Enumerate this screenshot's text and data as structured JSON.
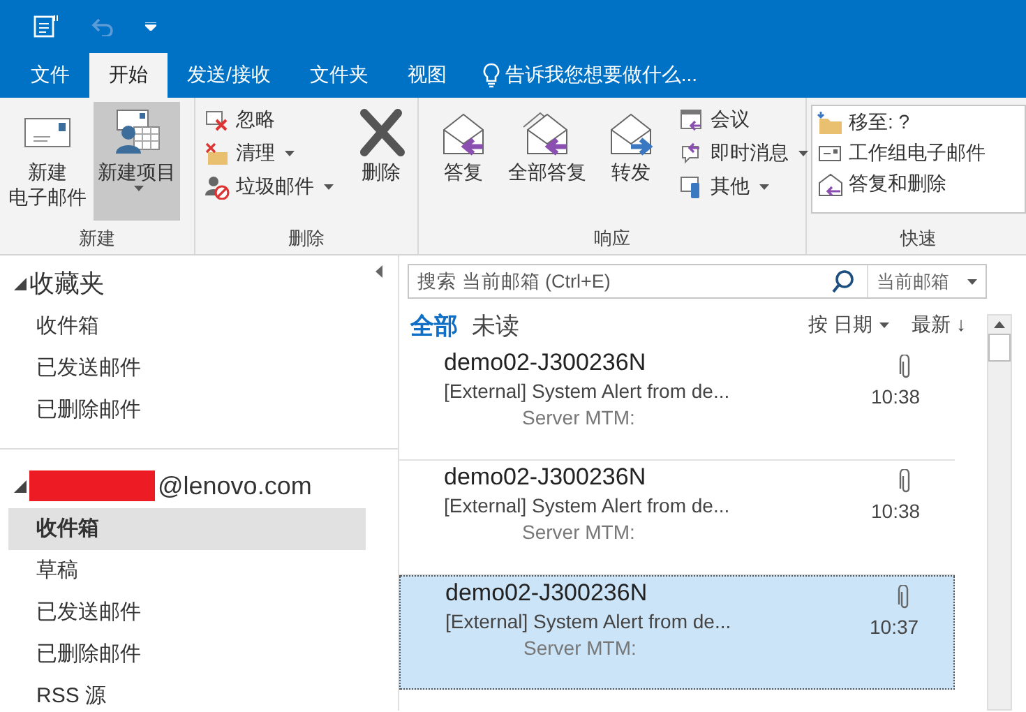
{
  "tabs": [
    {
      "label": "文件",
      "selected": false
    },
    {
      "label": "开始",
      "selected": true
    },
    {
      "label": "发送/接收",
      "selected": false
    },
    {
      "label": "文件夹",
      "selected": false
    },
    {
      "label": "视图",
      "selected": false
    }
  ],
  "tell_me": "告诉我您想要做什么...",
  "ribbon": {
    "groups": [
      {
        "label": "新建",
        "items": [
          {
            "kind": "large",
            "lines": [
              "新建",
              "电子邮件"
            ],
            "dropdown": false,
            "highlighted": false
          },
          {
            "kind": "large",
            "lines": [
              "新建项目"
            ],
            "dropdown": true,
            "highlighted": true
          }
        ]
      },
      {
        "label": "删除",
        "items": [
          {
            "kind": "stack",
            "buttons": [
              {
                "label": "忽略",
                "dropdown": false
              },
              {
                "label": "清理",
                "dropdown": true
              },
              {
                "label": "垃圾邮件",
                "dropdown": true
              }
            ]
          },
          {
            "kind": "large",
            "lines": [
              "删除"
            ],
            "dropdown": false,
            "highlighted": false
          }
        ]
      },
      {
        "label": "响应",
        "items": [
          {
            "kind": "large",
            "lines": [
              "答复"
            ],
            "dropdown": false,
            "highlighted": false
          },
          {
            "kind": "large",
            "lines": [
              "全部答复"
            ],
            "dropdown": false,
            "highlighted": false
          },
          {
            "kind": "large",
            "lines": [
              "转发"
            ],
            "dropdown": false,
            "highlighted": false
          },
          {
            "kind": "stack",
            "buttons": [
              {
                "label": "会议",
                "dropdown": false
              },
              {
                "label": "即时消息",
                "dropdown": true
              },
              {
                "label": "其他",
                "dropdown": true
              }
            ]
          }
        ]
      },
      {
        "label": "快速",
        "items": [
          {
            "kind": "gallery",
            "buttons": [
              {
                "label": "移至: ?",
                "dropdown": false
              },
              {
                "label": "工作组电子邮件",
                "dropdown": false
              },
              {
                "label": "答复和删除",
                "dropdown": false
              }
            ]
          }
        ]
      }
    ]
  },
  "nav": {
    "sections": [
      {
        "title": "收藏夹",
        "expanded": true,
        "redacted": false,
        "items": [
          {
            "label": "收件箱",
            "selected": false
          },
          {
            "label": "已发送邮件",
            "selected": false
          },
          {
            "label": "已删除邮件",
            "selected": false
          }
        ]
      },
      {
        "title": "@lenovo.com",
        "expanded": true,
        "redacted": true,
        "items": [
          {
            "label": "收件箱",
            "selected": true
          },
          {
            "label": "草稿",
            "selected": false
          },
          {
            "label": "已发送邮件",
            "selected": false
          },
          {
            "label": "已删除邮件",
            "selected": false
          },
          {
            "label": "RSS 源",
            "selected": false
          }
        ]
      }
    ]
  },
  "search": {
    "placeholder": "搜索 当前邮箱 (Ctrl+E)",
    "scope": "当前邮箱"
  },
  "filters": [
    {
      "label": "全部",
      "selected": true
    },
    {
      "label": "未读",
      "selected": false
    }
  ],
  "sort": {
    "by": "按 日期",
    "order": "最新 ↓"
  },
  "messages": [
    {
      "sender": "demo02-J300236N",
      "subject": "[External]  System Alert from de...",
      "preview": "Server MTM:",
      "time": "10:38",
      "attachment": true,
      "selected": false
    },
    {
      "sender": "demo02-J300236N",
      "subject": "[External]  System Alert from de...",
      "preview": "Server MTM:",
      "time": "10:38",
      "attachment": true,
      "selected": false
    },
    {
      "sender": "demo02-J300236N",
      "subject": "[External]  System Alert from de...",
      "preview": "Server MTM:",
      "time": "10:37",
      "attachment": true,
      "selected": true
    }
  ]
}
